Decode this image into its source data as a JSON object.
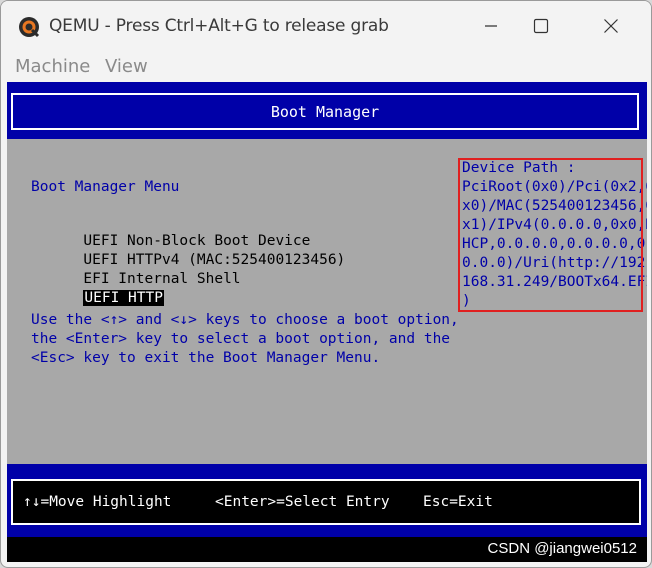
{
  "window": {
    "title": "QEMU - Press Ctrl+Alt+G to release grab",
    "icon": "qemu-logo-icon"
  },
  "menubar": {
    "items": [
      {
        "label": "Machine"
      },
      {
        "label": "View"
      }
    ]
  },
  "screen": {
    "header_title": "Boot Manager",
    "menu_heading": "Boot Manager Menu",
    "boot_options": [
      {
        "label": "UEFI Non-Block Boot Device",
        "selected": false
      },
      {
        "label": "UEFI HTTPv4 (MAC:525400123456)",
        "selected": false
      },
      {
        "label": "EFI Internal Shell",
        "selected": false
      },
      {
        "label": "UEFI HTTP",
        "selected": true
      }
    ],
    "help_lines": [
      "Use the <↑> and <↓> keys to choose a boot option,",
      "the <Enter> key to select a boot option, and the",
      "<Esc> key to exit the Boot Manager Menu."
    ],
    "device_path_lines": [
      "Device Path :",
      "PciRoot(0x0)/Pci(0x2,0",
      "x0)/MAC(525400123456,0",
      "x1)/IPv4(0.0.0.0,0x0,D",
      "HCP,0.0.0.0,0.0.0.0,0.",
      "0.0.0)/Uri(http://192.",
      "168.31.249/BOOTx64.EFI",
      ")"
    ],
    "footer": {
      "move": "↑↓=Move Highlight",
      "select": "<Enter>=Select Entry",
      "exit": "Esc=Exit"
    },
    "watermark": "CSDN @jiangwei0512"
  },
  "colors": {
    "bios_blue": "#0000a8",
    "bios_gray": "#a8a8a8",
    "annotation_red": "#e02020"
  }
}
